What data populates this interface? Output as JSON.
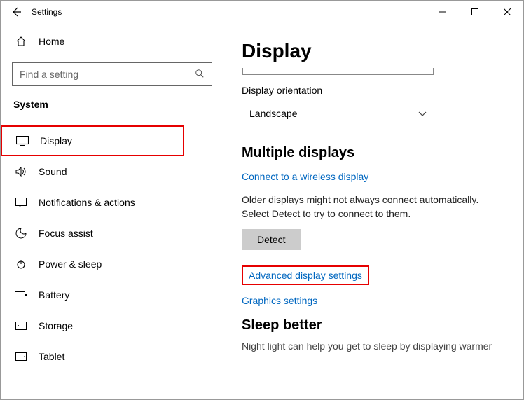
{
  "window": {
    "title": "Settings"
  },
  "sidebar": {
    "home_label": "Home",
    "search_placeholder": "Find a setting",
    "category_label": "System",
    "items": [
      {
        "icon": "display",
        "label": "Display"
      },
      {
        "icon": "sound",
        "label": "Sound"
      },
      {
        "icon": "notifications",
        "label": "Notifications & actions"
      },
      {
        "icon": "focus",
        "label": "Focus assist"
      },
      {
        "icon": "power",
        "label": "Power & sleep"
      },
      {
        "icon": "battery",
        "label": "Battery"
      },
      {
        "icon": "storage",
        "label": "Storage"
      },
      {
        "icon": "tablet",
        "label": "Tablet"
      }
    ]
  },
  "main": {
    "page_title": "Display",
    "orientation_label": "Display orientation",
    "orientation_value": "Landscape",
    "multiple_displays_header": "Multiple displays",
    "wireless_link": "Connect to a wireless display",
    "detect_text": "Older displays might not always connect automatically. Select Detect to try to connect to them.",
    "detect_button": "Detect",
    "advanced_link": "Advanced display settings",
    "graphics_link": "Graphics settings",
    "sleep_header": "Sleep better",
    "sleep_text": "Night light can help you get to sleep by displaying warmer"
  }
}
